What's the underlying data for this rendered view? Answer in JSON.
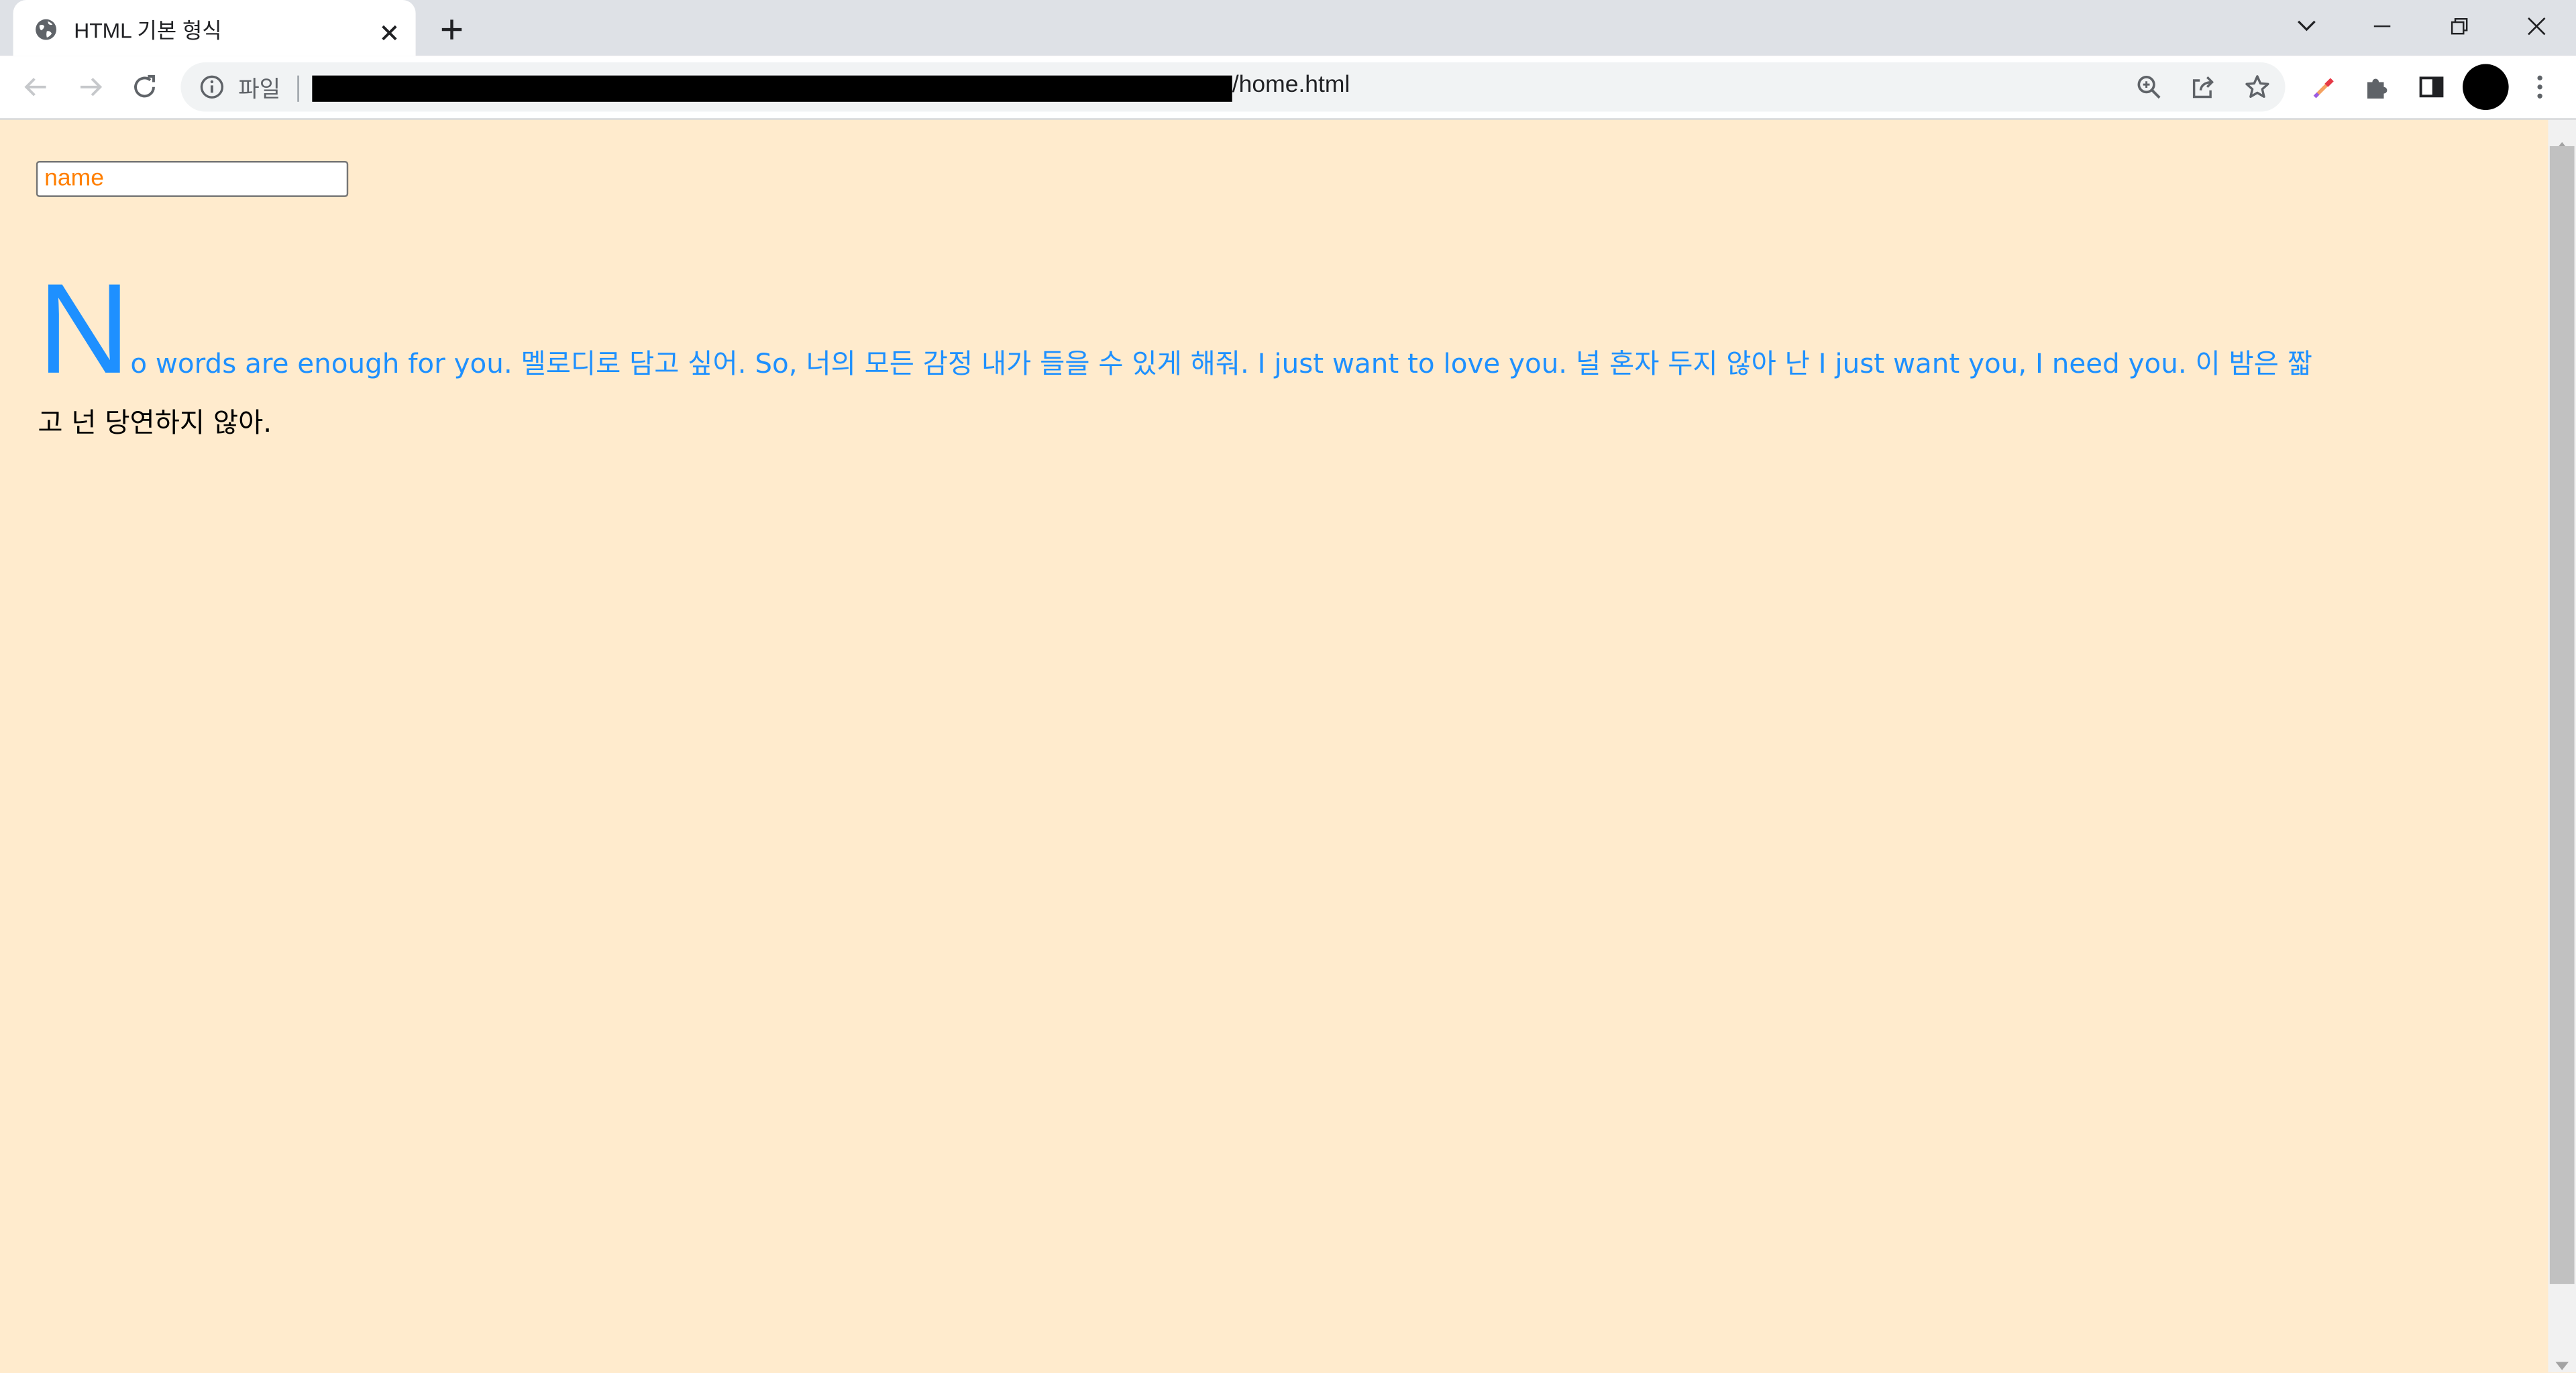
{
  "browser": {
    "tab_title": "HTML 기본 형식",
    "address": {
      "scheme_label": "파일",
      "url_suffix": "/home.html"
    }
  },
  "page": {
    "input_placeholder": "name",
    "drop_letter": "N",
    "first_line_text": "o words are enough for you. 멜로디로 담고 싶어. So, 너의 모든 감정 내가 들을 수 있게 해줘. I just want to love you. 널 혼자 두지 않아 난 I just want you, I need you. 이 밤은 짧",
    "rest_text": "고 넌 당연하지 않아."
  },
  "colors": {
    "page_background": "#ffebcd",
    "first_line_color": "#1e90ff",
    "placeholder_color": "#ff7f00",
    "body_text_color": "#000000"
  },
  "icons": {
    "tab": [
      "globe-icon",
      "close-icon",
      "plus-icon"
    ],
    "window": [
      "chevron-down-icon",
      "minimize-icon",
      "restore-icon",
      "close-icon"
    ],
    "toolbar": [
      "back-arrow-icon",
      "forward-arrow-icon",
      "reload-icon",
      "info-icon",
      "zoom-icon",
      "share-icon",
      "star-icon",
      "eyedropper-icon",
      "puzzle-icon",
      "side-panel-icon",
      "kebab-menu-icon"
    ]
  }
}
